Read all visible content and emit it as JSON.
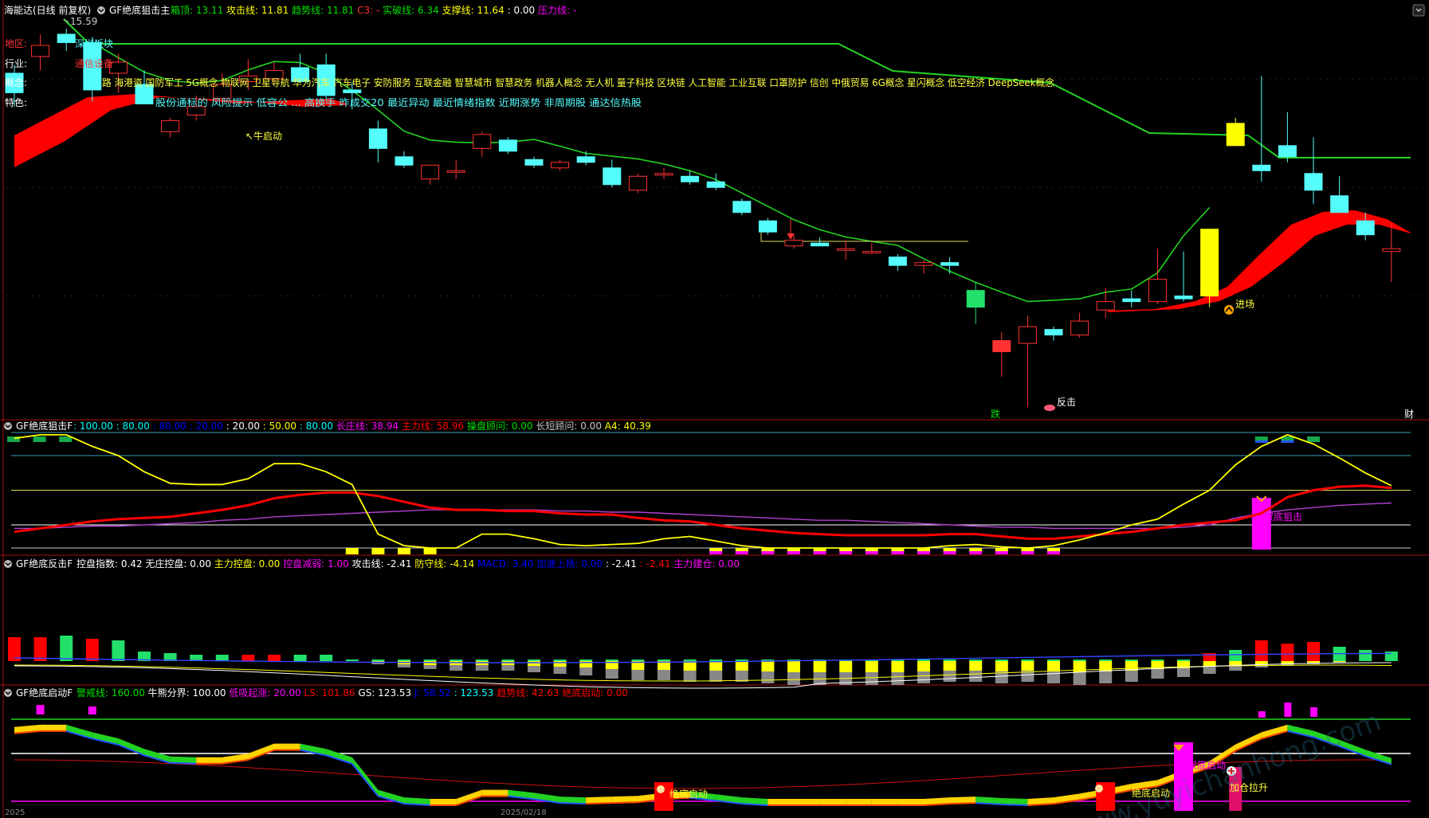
{
  "colors": {
    "up": "#ff3232",
    "down": "#54fcfc",
    "green_line": "#22d322",
    "yellow": "#ffff00",
    "red": "#ff0000",
    "magenta": "#ff00ff",
    "cyan": "#00ffff",
    "white": "#ffffff",
    "purple": "#b040d0",
    "label_gray": "#c8c8c8",
    "label_green": "#00e000"
  },
  "main": {
    "window_title": "海能达(日线 前复权)",
    "indicator_name": "GF绝底狙击主",
    "chevron_icon": "chevron-down-icon",
    "readouts": [
      {
        "label": "箱顶: ",
        "value": "13.11",
        "color": "#00e000"
      },
      {
        "label": "攻击线: ",
        "value": "11.81",
        "color": "#ffff00"
      },
      {
        "label": "趋势线: ",
        "value": "11.81",
        "color": "#00e000"
      },
      {
        "label": "C3: ",
        "value": "-",
        "color": "#ff3232"
      },
      {
        "label": "实破线: ",
        "value": "6.34",
        "color": "#00e000"
      },
      {
        "label": "支撑线: ",
        "value": "11.64",
        "color": "#ffff00"
      },
      {
        "label": " : ",
        "value": "0.00",
        "color": "#ffffff"
      },
      {
        "label": "压力线: ",
        "value": "-",
        "color": "#ff00ff"
      }
    ],
    "high_label": "15.59",
    "info": {
      "region_label": "地区:",
      "region_value": "深圳板块",
      "industry_label": "行业:",
      "industry_value": "通信设备",
      "concept_label": "概念:",
      "concept_value": "路 海港资 国防军工 5G概念 物联网 卫星导航 华为汽车 汽车电子 安防服务 互联金融 智慧城市 智慧政务 机器人概念 无人机 量子科技 区块链 人工智能 工业互联 口罩防护 信创 中俄贸易 6G概念 星闪概念 低空经济 DeepSeek概念",
      "tag_label": "特色:",
      "tag_value": "股份通标的 风险提示 低容公 ... 高换手 昨成交20 最近异动 最近情绪指数 近期涨势 非周期股 通达信热股"
    },
    "annotations": {
      "bull_start": "↖牛启动",
      "entry": "进场",
      "counter_attack": "反击",
      "drop_label": "跌",
      "finance_label": "财"
    }
  },
  "panel2": {
    "indicator_name": "GF绝底狙击F",
    "readouts": [
      {
        "label": " : ",
        "value": "100.00",
        "color": "#00ffff"
      },
      {
        "label": " : ",
        "value": "80.00",
        "color": "#00ffff"
      },
      {
        "label": " : ",
        "value": "80.00",
        "color": "#0000ff"
      },
      {
        "label": " : ",
        "value": "20.00",
        "color": "#0000ff"
      },
      {
        "label": " : ",
        "value": "20.00",
        "color": "#ffffff"
      },
      {
        "label": " : ",
        "value": "50.00",
        "color": "#ffff00"
      },
      {
        "label": " : ",
        "value": "80.00",
        "color": "#00ffff"
      },
      {
        "label": "长庄线: ",
        "value": "38.94",
        "color": "#ff00ff"
      },
      {
        "label": "主力线: ",
        "value": "58.96",
        "color": "#ff0000"
      },
      {
        "label": "操盘顾问: ",
        "value": "0.00",
        "color": "#00e000"
      },
      {
        "label": "长短顾问: ",
        "value": "0.00",
        "color": "#c8c8c8"
      },
      {
        "label": "A4: ",
        "value": "40.39",
        "color": "#ffff00"
      }
    ],
    "annotation": "双底狙击"
  },
  "panel3": {
    "indicator_name": "GF绝底反击F",
    "readouts": [
      {
        "label": "控盘指数: ",
        "value": "0.42",
        "color": "#ffffff"
      },
      {
        "label": "无庄控盘: ",
        "value": "0.00",
        "color": "#ffffff"
      },
      {
        "label": "主力控盘: ",
        "value": "0.00",
        "color": "#ffff00"
      },
      {
        "label": "控盘减弱: ",
        "value": "1.00",
        "color": "#ff00ff"
      },
      {
        "label": "攻击线: ",
        "value": "-2.41",
        "color": "#ffffff"
      },
      {
        "label": "防守线: ",
        "value": "-4.14",
        "color": "#ffff00"
      },
      {
        "label": "MACD: ",
        "value": "3.40",
        "color": "#0000ff"
      },
      {
        "label": "加速上扬: ",
        "value": "0.00",
        "color": "#0000ff"
      },
      {
        "label": " : ",
        "value": "-2.41",
        "color": "#ffffff"
      },
      {
        "label": " : ",
        "value": "-2.41",
        "color": "#ff0000"
      },
      {
        "label": "主力建仓: ",
        "value": "0.00",
        "color": "#ff00ff"
      }
    ]
  },
  "panel4": {
    "indicator_name": "GF绝底启动F",
    "readouts": [
      {
        "label": "警戒线: ",
        "value": "160.00",
        "color": "#00e000"
      },
      {
        "label": "牛熊分界: ",
        "value": "100.00",
        "color": "#ffffff"
      },
      {
        "label": "低吸起涨: ",
        "value": "20.00",
        "color": "#ff00ff"
      },
      {
        "label": "LS: ",
        "value": "101.86",
        "color": "#ff0000"
      },
      {
        "label": "GS: ",
        "value": "123.53",
        "color": "#ffffff"
      },
      {
        "label": "J: ",
        "value": "58.52",
        "color": "#0000ff"
      },
      {
        "label": " : ",
        "value": "123.53",
        "color": "#00ffff"
      },
      {
        "label": "趋势线: ",
        "value": "42.63",
        "color": "#ff0000"
      },
      {
        "label": "绝底启动: ",
        "value": "0.00",
        "color": "#ff0000"
      }
    ],
    "annotations": {
      "start_1": "绝底启动",
      "start_2": "绝底启动",
      "double_bottom": "双底启动",
      "add_position": "加仓拉升"
    }
  },
  "watermark": "www.yuyichanhong.com",
  "footer": {
    "left": "2025",
    "mid": "2025/02/18"
  },
  "chart_data": [
    {
      "type": "candlestick",
      "title": "海能达(日线 前复权)",
      "series_name": "GF绝底狙击主",
      "ohlc": [
        [
          14.2,
          14.5,
          13.0,
          13.5
        ],
        [
          14.8,
          15.59,
          14.3,
          15.2
        ],
        [
          15.6,
          15.8,
          15.0,
          15.3
        ],
        [
          15.3,
          15.5,
          13.2,
          13.6
        ],
        [
          14.2,
          14.9,
          13.5,
          14.6
        ],
        [
          13.8,
          14.3,
          13.6,
          13.1
        ],
        [
          12.1,
          12.6,
          11.9,
          12.5
        ],
        [
          12.7,
          13.4,
          12.5,
          13.0
        ],
        [
          13.3,
          14.2,
          13.1,
          13.8
        ],
        [
          13.9,
          14.7,
          13.6,
          14.1
        ],
        [
          14.0,
          14.6,
          13.8,
          14.3
        ],
        [
          14.4,
          14.9,
          14.0,
          13.9
        ],
        [
          14.5,
          14.9,
          13.2,
          13.4
        ],
        [
          13.6,
          13.9,
          12.9,
          13.5
        ],
        [
          12.2,
          12.5,
          11.0,
          11.5
        ],
        [
          11.2,
          11.4,
          10.8,
          10.9
        ],
        [
          10.4,
          10.9,
          10.2,
          10.9
        ],
        [
          10.7,
          11.1,
          10.4,
          10.7
        ],
        [
          11.5,
          12.1,
          11.2,
          12.0
        ],
        [
          11.8,
          11.9,
          11.3,
          11.4
        ],
        [
          11.1,
          11.2,
          10.8,
          10.9
        ],
        [
          10.8,
          11.1,
          10.7,
          11.0
        ],
        [
          11.2,
          11.4,
          10.9,
          11.0
        ],
        [
          10.8,
          11.1,
          10.1,
          10.2
        ],
        [
          10.0,
          10.6,
          9.9,
          10.5
        ],
        [
          10.6,
          10.8,
          10.4,
          10.6
        ],
        [
          10.5,
          10.7,
          10.2,
          10.3
        ],
        [
          10.3,
          10.6,
          10.0,
          10.1
        ],
        [
          9.6,
          9.7,
          9.1,
          9.2
        ],
        [
          8.9,
          9.0,
          8.4,
          8.5
        ],
        [
          8.0,
          8.4,
          7.9,
          8.2
        ],
        [
          8.1,
          8.3,
          8.0,
          8.0
        ],
        [
          7.9,
          8.2,
          7.5,
          7.9
        ],
        [
          7.8,
          8.1,
          7.7,
          7.8
        ],
        [
          7.6,
          7.7,
          7.1,
          7.3
        ],
        [
          7.3,
          7.5,
          7.0,
          7.4
        ],
        [
          7.4,
          7.6,
          7.0,
          7.3
        ],
        [
          6.4,
          6.7,
          5.2,
          5.8
        ],
        [
          4.2,
          4.9,
          3.3,
          4.6
        ],
        [
          4.5,
          5.5,
          2.2,
          5.1
        ],
        [
          5.0,
          5.1,
          4.6,
          4.8
        ],
        [
          4.8,
          5.6,
          4.7,
          5.3
        ],
        [
          5.7,
          6.5,
          5.4,
          6.0
        ],
        [
          6.1,
          6.4,
          5.8,
          6.0
        ],
        [
          6.0,
          7.9,
          5.9,
          6.8
        ],
        [
          6.2,
          7.8,
          6.0,
          6.1
        ],
        [
          6.2,
          7.6,
          5.8,
          8.6
        ],
        [
          12.4,
          12.6,
          11.6,
          11.6
        ],
        [
          10.9,
          14.1,
          10.3,
          10.7
        ],
        [
          11.6,
          12.8,
          11.0,
          11.2
        ],
        [
          10.6,
          11.9,
          9.5,
          10.0
        ],
        [
          9.8,
          10.5,
          9.4,
          9.2
        ],
        [
          8.9,
          9.2,
          8.2,
          8.4
        ],
        [
          7.8,
          8.8,
          6.7,
          7.9
        ]
      ]
    },
    {
      "type": "line",
      "series_name": "GF绝底狙击F",
      "series": [
        {
          "name": "长庄线",
          "color": "#b040d0",
          "values": [
            17,
            17,
            18,
            19,
            19,
            20,
            21,
            22,
            24,
            25,
            27,
            28,
            29,
            30,
            31,
            32,
            33,
            33,
            33,
            33,
            33,
            32,
            32,
            31,
            31,
            30,
            29,
            28,
            27,
            26,
            25,
            24,
            24,
            23,
            22,
            21,
            20,
            19,
            18,
            18,
            17,
            17,
            17,
            17,
            17,
            18,
            20,
            26,
            30,
            33,
            35,
            37,
            38,
            39
          ]
        },
        {
          "name": "主力线",
          "color": "#ff0000",
          "values": [
            14,
            17,
            20,
            23,
            25,
            26,
            27,
            30,
            33,
            37,
            43,
            46,
            48,
            48,
            45,
            40,
            35,
            33,
            33,
            32,
            32,
            30,
            29,
            29,
            26,
            24,
            23,
            20,
            17,
            15,
            13,
            12,
            11,
            11,
            11,
            11,
            12,
            12,
            10,
            8,
            8,
            10,
            12,
            14,
            17,
            20,
            22,
            24,
            30,
            44,
            50,
            53,
            54,
            52
          ]
        },
        {
          "name": "A4",
          "color": "#ffff00",
          "values": [
            95,
            98,
            98,
            88,
            80,
            66,
            56,
            55,
            55,
            60,
            73,
            73,
            66,
            55,
            12,
            2,
            0,
            0,
            12,
            12,
            8,
            3,
            2,
            3,
            4,
            8,
            10,
            6,
            2,
            0,
            0,
            0,
            0,
            0,
            0,
            0,
            2,
            3,
            1,
            0,
            2,
            7,
            13,
            20,
            25,
            38,
            50,
            72,
            88,
            98,
            90,
            78,
            65,
            54
          ]
        }
      ]
    }
  ]
}
